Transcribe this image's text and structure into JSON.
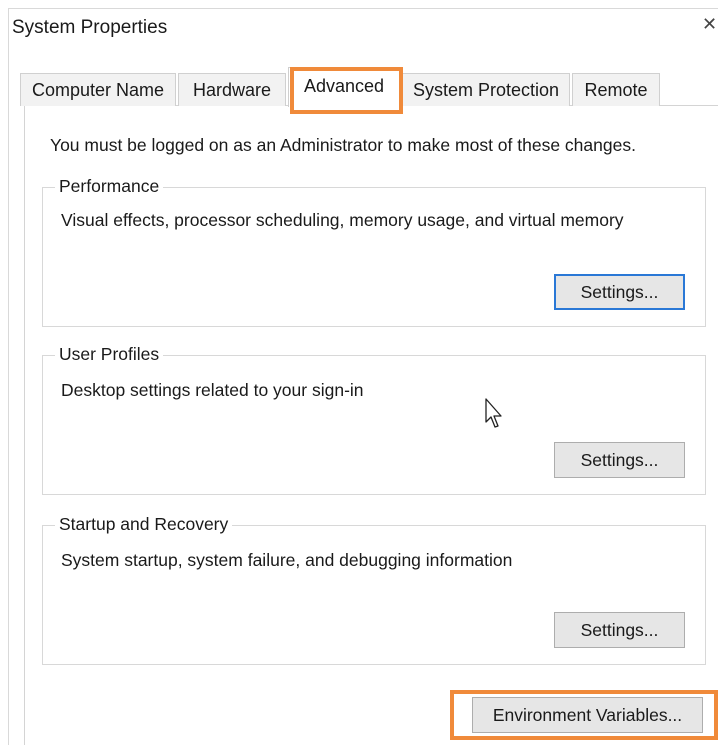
{
  "window": {
    "title": "System Properties",
    "close_glyph": "✕"
  },
  "tabs": [
    {
      "label": "Computer Name",
      "active": false
    },
    {
      "label": "Hardware",
      "active": false
    },
    {
      "label": "Advanced",
      "active": true
    },
    {
      "label": "System Protection",
      "active": false
    },
    {
      "label": "Remote",
      "active": false
    }
  ],
  "notice": "You must be logged on as an Administrator to make most of these changes.",
  "groups": {
    "performance": {
      "title": "Performance",
      "description": "Visual effects, processor scheduling, memory usage, and virtual memory",
      "button": "Settings..."
    },
    "user_profiles": {
      "title": "User Profiles",
      "description": "Desktop settings related to your sign-in",
      "button": "Settings..."
    },
    "startup_recovery": {
      "title": "Startup and Recovery",
      "description": "System startup, system failure, and debugging information",
      "button": "Settings..."
    }
  },
  "env_button": "Environment Variables...",
  "colors": {
    "highlight": "#f08a3a",
    "focus": "#2a78d6",
    "button_bg": "#e6e6e6"
  },
  "icons": {
    "cursor": "mouse-pointer-icon",
    "close": "close-icon"
  }
}
